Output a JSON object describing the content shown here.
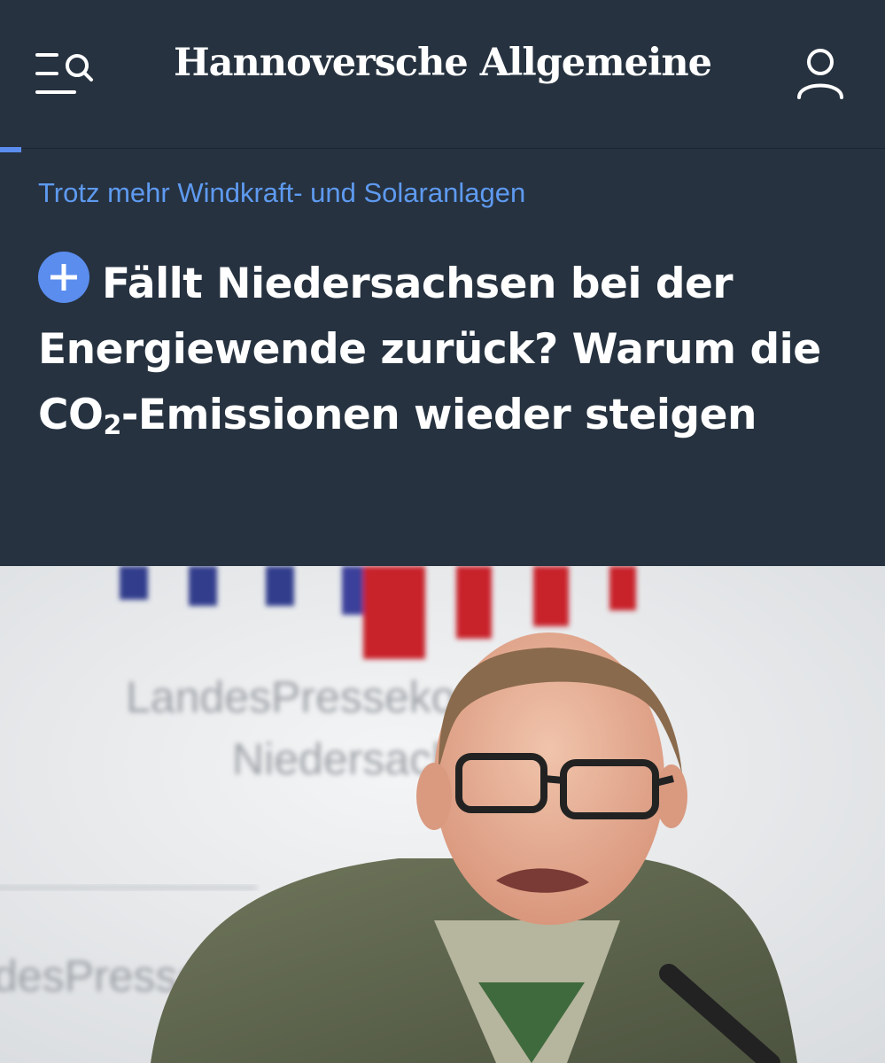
{
  "header": {
    "logo_text": "Hannoversche Allgemeine",
    "menu_icon": "menu-search-icon",
    "account_icon": "user-icon"
  },
  "article": {
    "kicker": "Trotz mehr Windkraft- und Solaranlagen",
    "headline_badge_icon": "plus-icon",
    "headline_part1": "Fällt Niedersachsen bei der Energiewende zurück? Warum die CO",
    "headline_sub": "2",
    "headline_part2": "-Emissionen wieder steigen"
  },
  "photo": {
    "backdrop_text_line1": "LandesPressekonferenz",
    "backdrop_text_line2": "Niedersachsen",
    "backdrop_text_lower": "desPressekonferenz"
  },
  "colors": {
    "header_bg": "#263240",
    "accent": "#5b8def",
    "kicker": "#5e9af0"
  }
}
